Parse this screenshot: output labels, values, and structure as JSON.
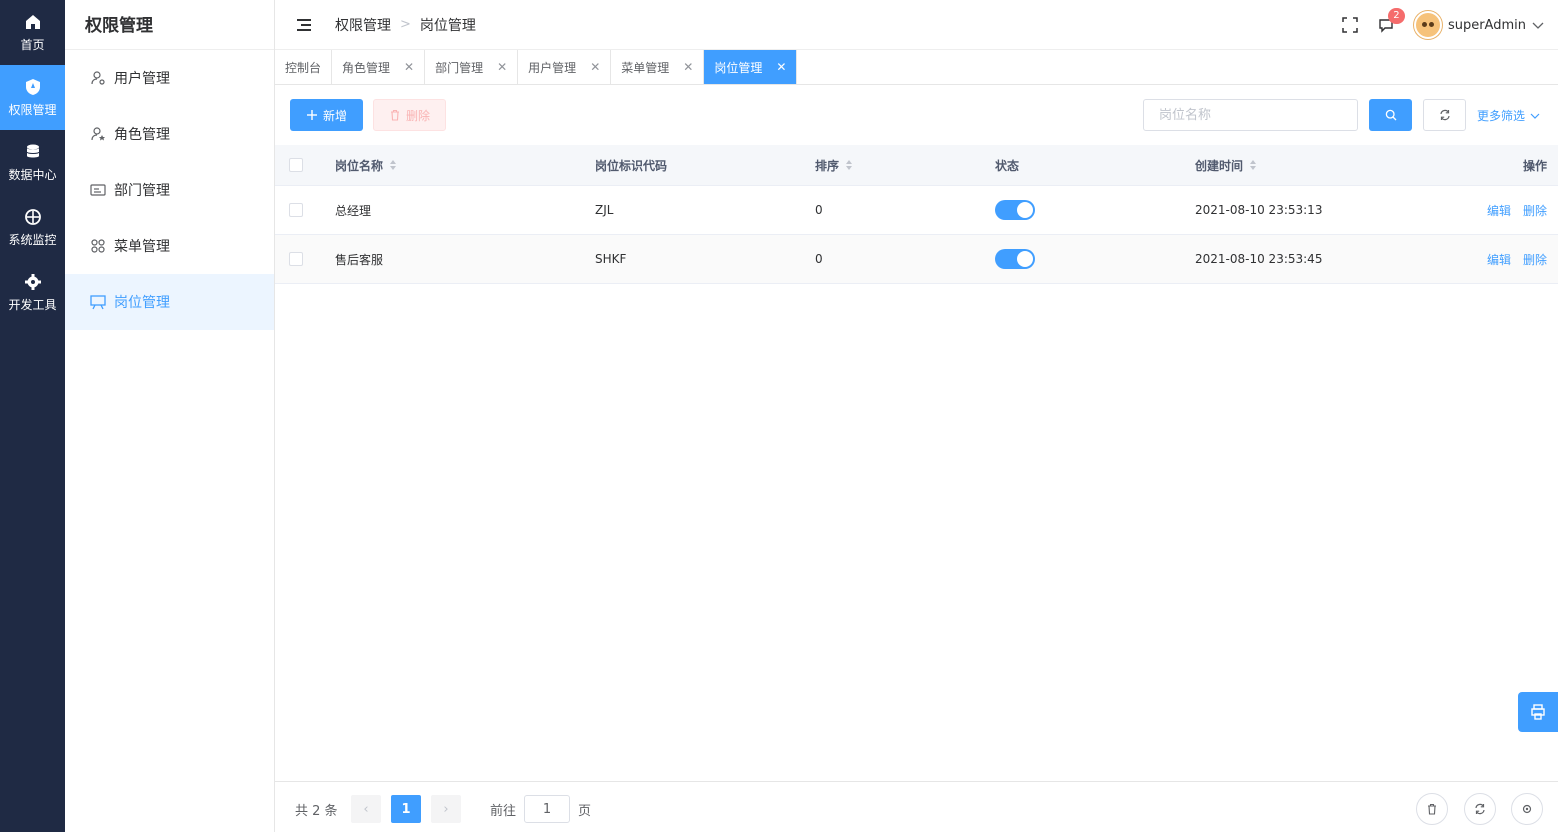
{
  "rail": {
    "items": [
      {
        "label": "首页",
        "icon": "home-icon"
      },
      {
        "label": "权限管理",
        "icon": "shield-icon"
      },
      {
        "label": "数据中心",
        "icon": "database-icon"
      },
      {
        "label": "系统监控",
        "icon": "crosshair-icon"
      },
      {
        "label": "开发工具",
        "icon": "gear-icon"
      }
    ],
    "active_index": 1
  },
  "submenu": {
    "title": "权限管理",
    "items": [
      {
        "label": "用户管理",
        "icon": "user-gear-icon"
      },
      {
        "label": "角色管理",
        "icon": "user-star-icon"
      },
      {
        "label": "部门管理",
        "icon": "id-card-icon"
      },
      {
        "label": "菜单管理",
        "icon": "grid-icon"
      },
      {
        "label": "岗位管理",
        "icon": "presentation-icon"
      }
    ],
    "active_index": 4
  },
  "header": {
    "breadcrumb": [
      "权限管理",
      "岗位管理"
    ],
    "notification_count": "2",
    "username": "superAdmin"
  },
  "tabs": [
    {
      "label": "控制台",
      "closable": false
    },
    {
      "label": "角色管理",
      "closable": true
    },
    {
      "label": "部门管理",
      "closable": true
    },
    {
      "label": "用户管理",
      "closable": true
    },
    {
      "label": "菜单管理",
      "closable": true
    },
    {
      "label": "岗位管理",
      "closable": true,
      "active": true
    }
  ],
  "toolbar": {
    "add_label": "新增",
    "delete_label": "删除",
    "search_placeholder": "岗位名称",
    "more_filter_label": "更多筛选"
  },
  "table": {
    "columns": [
      "岗位名称",
      "岗位标识代码",
      "排序",
      "状态",
      "创建时间",
      "操作"
    ],
    "rows": [
      {
        "name": "总经理",
        "code": "ZJL",
        "sort": "0",
        "status": true,
        "created": "2021-08-10 23:53:13",
        "edit": "编辑",
        "delete": "删除"
      },
      {
        "name": "售后客服",
        "code": "SHKF",
        "sort": "0",
        "status": true,
        "created": "2021-08-10 23:53:45",
        "edit": "编辑",
        "delete": "删除"
      }
    ]
  },
  "pagination": {
    "total_label": "共 2 条",
    "current_page": "1",
    "goto_prefix": "前往",
    "goto_value": "1",
    "goto_suffix": "页"
  },
  "colors": {
    "rail_bg": "#1f2a44",
    "accent": "#409eff",
    "danger_light": "#fef0f0"
  }
}
